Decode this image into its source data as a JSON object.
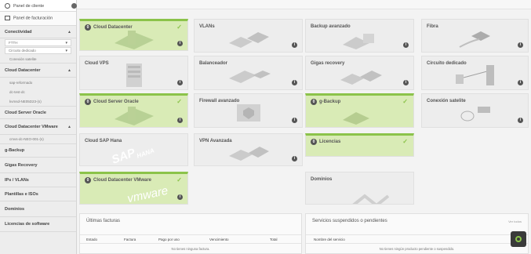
{
  "sidebar": {
    "panel_cliente": "Panel de cliente",
    "panel_facturacion": "Panel de facturación",
    "conectividad": "Conectividad",
    "conectividad_caret": "▲",
    "ftth": "FTTH",
    "circuito_dedicado": "Circuito dedicado",
    "conexion_satelite": "Conexión satelite",
    "cloud_datacenter": "Cloud Datacenter",
    "cloud_datacenter_caret": "▲",
    "cd_sub1": "sap-reformado",
    "cd_sub2": "dc-test-dc",
    "cd_sub3": "kvmsd-NE05D23-(s)",
    "cloud_server_oracle": "Cloud Server Oracle",
    "cloud_datacenter_vmware": "Cloud Datacenter VMware",
    "vmware_caret": "▲",
    "vmware_sub1": "cmvs-dc-NEO-001-(s)",
    "gbackup": "g-Backup",
    "gigas_recovery": "Gigas Recovery",
    "ips_vlans": "IPs / VLANs",
    "plantillas_isos": "Plantillas e ISOs",
    "dominios": "Dominios",
    "licencias_software": "Licencias de software"
  },
  "cards": {
    "cloud_datacenter": "Cloud Datacenter",
    "vlans": "VLANs",
    "backup_avanzado": "Backup avanzado",
    "fibra": "Fibra",
    "cloud_vps": "Cloud VPS",
    "balanceador": "Balanceador",
    "gigas_recovery": "Gigas recovery",
    "circuito_dedicado": "Circuito dedicado",
    "cloud_server_oracle": "Cloud Server Oracle",
    "firewall_avanzado": "Firewall avanzado",
    "gbackup": "g-Backup",
    "conexion_satelite": "Conexión satelite",
    "cloud_sap_hana": "Cloud SAP Hana",
    "vpn_avanzada": "VPN Avanzada",
    "licencias": "Licencias",
    "cloud_datacenter_vmware": "Cloud Datacenter VMware",
    "dominios": "Dominios",
    "badge_char": "0",
    "info_char": "i",
    "check_char": "✓",
    "sap_logo": "SAP",
    "hana_logo": "HANA",
    "vmware_logo": "vmware"
  },
  "facturas": {
    "title": "Últimas facturas",
    "col_estado": "Estado",
    "col_factura": "Factura",
    "col_pago": "Pago por uso",
    "col_vencimiento": "Vencimiento",
    "col_total": "Total",
    "empty": "No tienes ninguna factura."
  },
  "servicios": {
    "title": "Servicios suspendidos o pendientes",
    "link": "Ver todos",
    "col_nombre": "Nombre del servicio",
    "empty": "No tienes ningún producto pendiente o suspendido."
  },
  "colors": {
    "accent": "#8bc34a",
    "active_card": "#d9ebb6"
  }
}
